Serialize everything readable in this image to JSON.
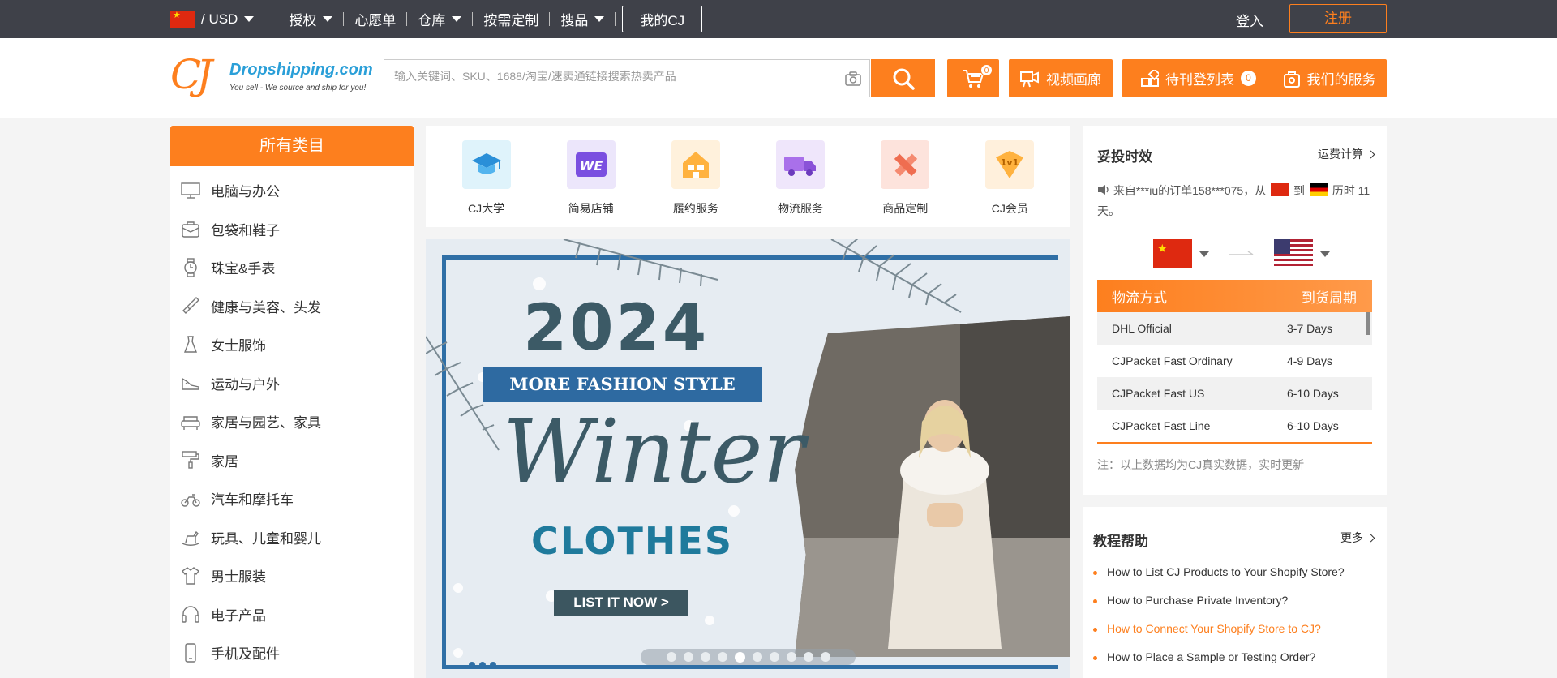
{
  "topbar": {
    "currency": "/ USD",
    "nav": [
      {
        "label": "授权",
        "dropdown": true
      },
      {
        "label": "心愿单",
        "dropdown": false
      },
      {
        "label": "仓库",
        "dropdown": true
      },
      {
        "label": "按需定制",
        "dropdown": false
      },
      {
        "label": "搜品",
        "dropdown": true
      }
    ],
    "my_cj": "我的CJ",
    "login": "登入",
    "register": "注册"
  },
  "header": {
    "logo_mark": "CJ",
    "logo_brand": "Dropshipping.com",
    "logo_slogan": "You sell - We source and ship for you!",
    "search_placeholder": "输入关键词、SKU、1688/淘宝/速卖通链接搜索热卖产品",
    "cart_count": "0",
    "video_gallery": "视频画廊",
    "pending_list": "待刊登列表",
    "pending_count": "0",
    "our_services": "我们的服务"
  },
  "categories": {
    "title": "所有类目",
    "items": [
      {
        "label": "电脑与办公",
        "icon": "monitor-icon"
      },
      {
        "label": "包袋和鞋子",
        "icon": "bag-icon"
      },
      {
        "label": "珠宝&手表",
        "icon": "watch-icon"
      },
      {
        "label": "健康与美容、头发",
        "icon": "brush-icon"
      },
      {
        "label": "女士服饰",
        "icon": "dress-icon"
      },
      {
        "label": "运动与户外",
        "icon": "shoe-icon"
      },
      {
        "label": "家居与园艺、家具",
        "icon": "sofa-icon"
      },
      {
        "label": "家居",
        "icon": "paint-roller-icon"
      },
      {
        "label": "汽车和摩托车",
        "icon": "motorcycle-icon"
      },
      {
        "label": "玩具、儿童和婴儿",
        "icon": "rocking-horse-icon"
      },
      {
        "label": "男士服装",
        "icon": "shirt-icon"
      },
      {
        "label": "电子产品",
        "icon": "headphones-icon"
      },
      {
        "label": "手机及配件",
        "icon": "phone-icon"
      }
    ]
  },
  "quick_links": [
    {
      "label": "CJ大学",
      "icon": "graduation-cap-icon"
    },
    {
      "label": "简易店铺",
      "icon": "we-store-icon"
    },
    {
      "label": "履约服务",
      "icon": "warehouse-icon"
    },
    {
      "label": "物流服务",
      "icon": "truck-icon"
    },
    {
      "label": "商品定制",
      "icon": "ruler-pencil-icon"
    },
    {
      "label": "CJ会员",
      "icon": "vip-badge-icon"
    }
  ],
  "banner": {
    "year": "2024",
    "ribbon": "MORE FASHION STYLE",
    "headline": "Winter",
    "subheadline": "CLOTHES",
    "cta": "LIST IT NOW >",
    "slide_count": 10,
    "active_slide": 5
  },
  "shipping": {
    "title": "妥投时效",
    "calc_link": "运费计算",
    "msg_part1": "来自***iu的订单158***075，从",
    "msg_to": "到",
    "msg_part2": "历时",
    "msg_part3": "11 天。",
    "col_method": "物流方式",
    "col_period": "到货周期",
    "rows": [
      {
        "method": "DHL Official",
        "period": "3-7 Days"
      },
      {
        "method": "CJPacket Fast Ordinary",
        "period": "4-9 Days"
      },
      {
        "method": "CJPacket Fast US",
        "period": "6-10 Days"
      },
      {
        "method": "CJPacket Fast Line",
        "period": "6-10 Days"
      }
    ],
    "note": "注：以上数据均为CJ真实数据，实时更新"
  },
  "tutorial": {
    "title": "教程帮助",
    "more": "更多",
    "items": [
      {
        "text": "How to List CJ Products to Your Shopify Store?",
        "highlight": false
      },
      {
        "text": "How to Purchase Private Inventory?",
        "highlight": false
      },
      {
        "text": "How to Connect Your Shopify Store to CJ?",
        "highlight": true
      },
      {
        "text": "How to Place a Sample or Testing Order?",
        "highlight": false
      }
    ]
  },
  "colors": {
    "accent": "#fd7f1e",
    "topbar_bg": "#3f4149",
    "page_bg": "#f4f4f4"
  }
}
